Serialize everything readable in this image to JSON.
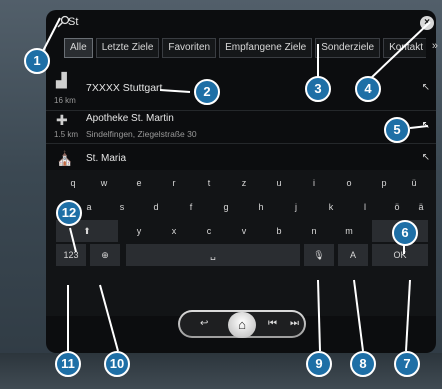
{
  "search": {
    "query": "St",
    "clear_icon": "close-icon"
  },
  "tabs": [
    "Alle",
    "Letzte Ziele",
    "Favoriten",
    "Empfangene Ziele",
    "Sonderziele",
    "Kontakt"
  ],
  "tabs_more": "»",
  "results": [
    {
      "icon": "city-icon",
      "distance": "16 km",
      "name": "7XXXX Stuttgart",
      "address": ""
    },
    {
      "icon": "pharmacy-icon",
      "distance": "1.5 km",
      "name": "Apotheke St. Martin",
      "address": "Sindelfingen, Ziegelstraße 30"
    },
    {
      "icon": "church-icon",
      "distance": "",
      "name": "St. Maria",
      "address": ""
    }
  ],
  "keyboard": {
    "row1": [
      "q",
      "w",
      "e",
      "r",
      "t",
      "z",
      "u",
      "i",
      "o",
      "p",
      "ü"
    ],
    "row2": [
      "a",
      "s",
      "d",
      "f",
      "g",
      "h",
      "j",
      "k",
      "l",
      "ö",
      "ä"
    ],
    "row3": [
      "y",
      "x",
      "c",
      "v",
      "b",
      "n",
      "m"
    ],
    "shift": "⬆",
    "backspace": "⌫",
    "numbers": "123",
    "language": "⊕",
    "space": "␣",
    "voice": "🎙",
    "case": "A",
    "ok": "OK"
  },
  "callouts": [
    "1",
    "2",
    "3",
    "4",
    "5",
    "6",
    "7",
    "8",
    "9",
    "10",
    "11",
    "12"
  ],
  "colors": {
    "callout": "#1e6fa6",
    "screen": "#0c0d0f"
  }
}
